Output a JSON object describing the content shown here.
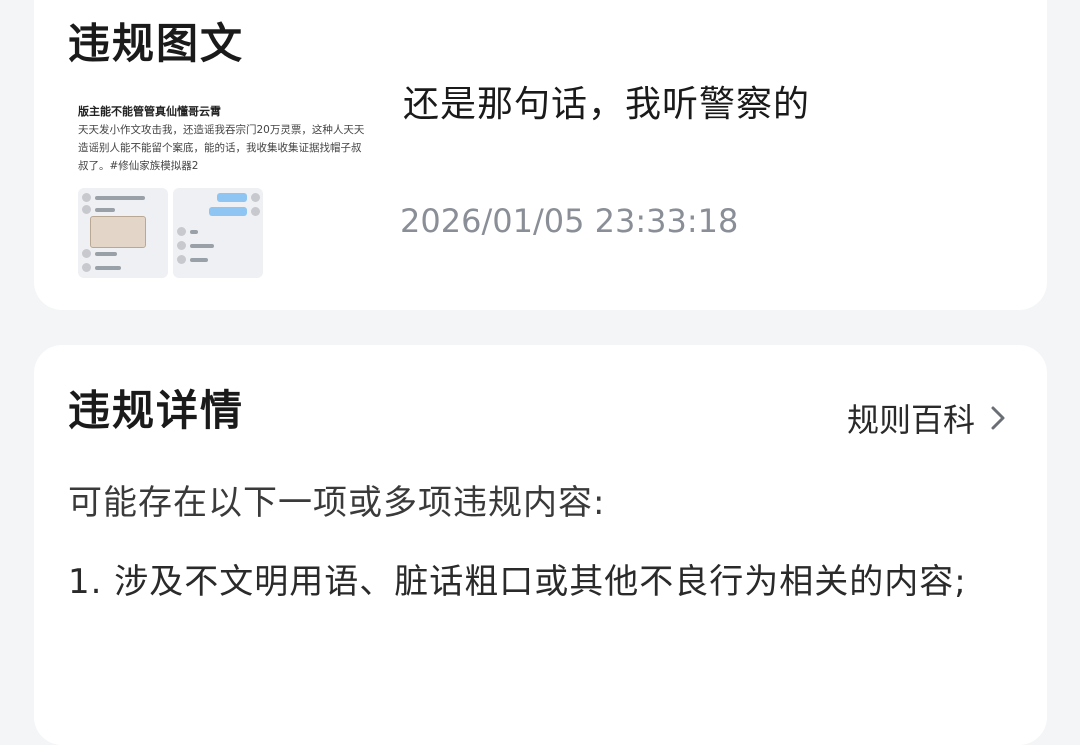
{
  "violation_content": {
    "title": "违规图文",
    "post_preview": {
      "title": "版主能不能管管真仙懂哥云霄",
      "body": "天天发小作文攻击我，还造谣我吞宗门20万灵票，这种人天天造谣别人能不能留个案底，能的话，我收集收集证据找帽子叔叔了。#修仙家族模拟器2"
    },
    "message": "还是那句话，我听警察的",
    "timestamp": "2026/01/05 23:33:18"
  },
  "violation_details": {
    "title": "违规详情",
    "rules_link": "规则百科",
    "description": "可能存在以下一项或多项违规内容:",
    "items": [
      "1. 涉及不文明用语、脏话粗口或其他不良行为相关的内容;"
    ]
  },
  "icons": {
    "rules_chevron": "chevron-right-icon"
  },
  "colors": {
    "background": "#f4f5f7",
    "card": "#ffffff",
    "timestamp": "#8a8e96"
  }
}
